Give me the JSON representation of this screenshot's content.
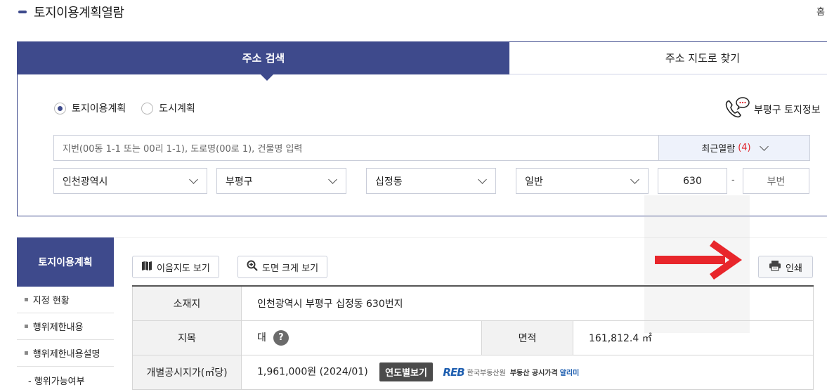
{
  "header": {
    "title": "토지이용계획열람",
    "home_link": "홈"
  },
  "tabs": [
    {
      "label": "주소 검색",
      "active": true
    },
    {
      "label": "주소 지도로 찾기",
      "active": false
    }
  ],
  "radios": [
    {
      "label": "토지이용계획",
      "checked": true
    },
    {
      "label": "도시계획",
      "checked": false
    }
  ],
  "contact": {
    "label": "부평구 토지정보",
    "icon": "phone-chat-icon"
  },
  "search": {
    "placeholder": "지번(00동 1-1 또는 00리 1-1), 도로명(00로 1), 건물명 입력",
    "recent_label": "최근열람",
    "recent_count": "(4)"
  },
  "selects": {
    "city": "인천광역시",
    "district": "부평구",
    "dong": "십정동",
    "type": "일반",
    "main_number": "630",
    "dash": "-",
    "sub_number_placeholder": "부번"
  },
  "side_menu": {
    "header": "토지이용계획",
    "items": [
      "지정 현황",
      "행위제한내용",
      "행위제한내용설명"
    ],
    "sub_items": [
      "- 행위가능여부"
    ]
  },
  "toolbar": {
    "map_button": "이음지도 보기",
    "zoom_button": "도면 크게 보기",
    "print_button": "인쇄"
  },
  "info": {
    "location_label": "소재지",
    "location_value": "인천광역시 부평구 십정동 630번지",
    "category_label": "지목",
    "category_value": "대",
    "help": "?",
    "area_label": "면적",
    "area_value": "161,812.4 ㎡",
    "price_label": "개별공시지가(㎡당)",
    "price_value": "1,961,000원 (2024/01)",
    "year_button": "연도별보기",
    "reb_mark": "REB",
    "reb_org": "한국부동산원",
    "reb_price": "부동산 공시가격",
    "reb_alert": "알리미"
  },
  "colors": {
    "primary": "#3e4a8c",
    "accent_red": "#e0242c",
    "arrow_red": "#e8262b"
  }
}
